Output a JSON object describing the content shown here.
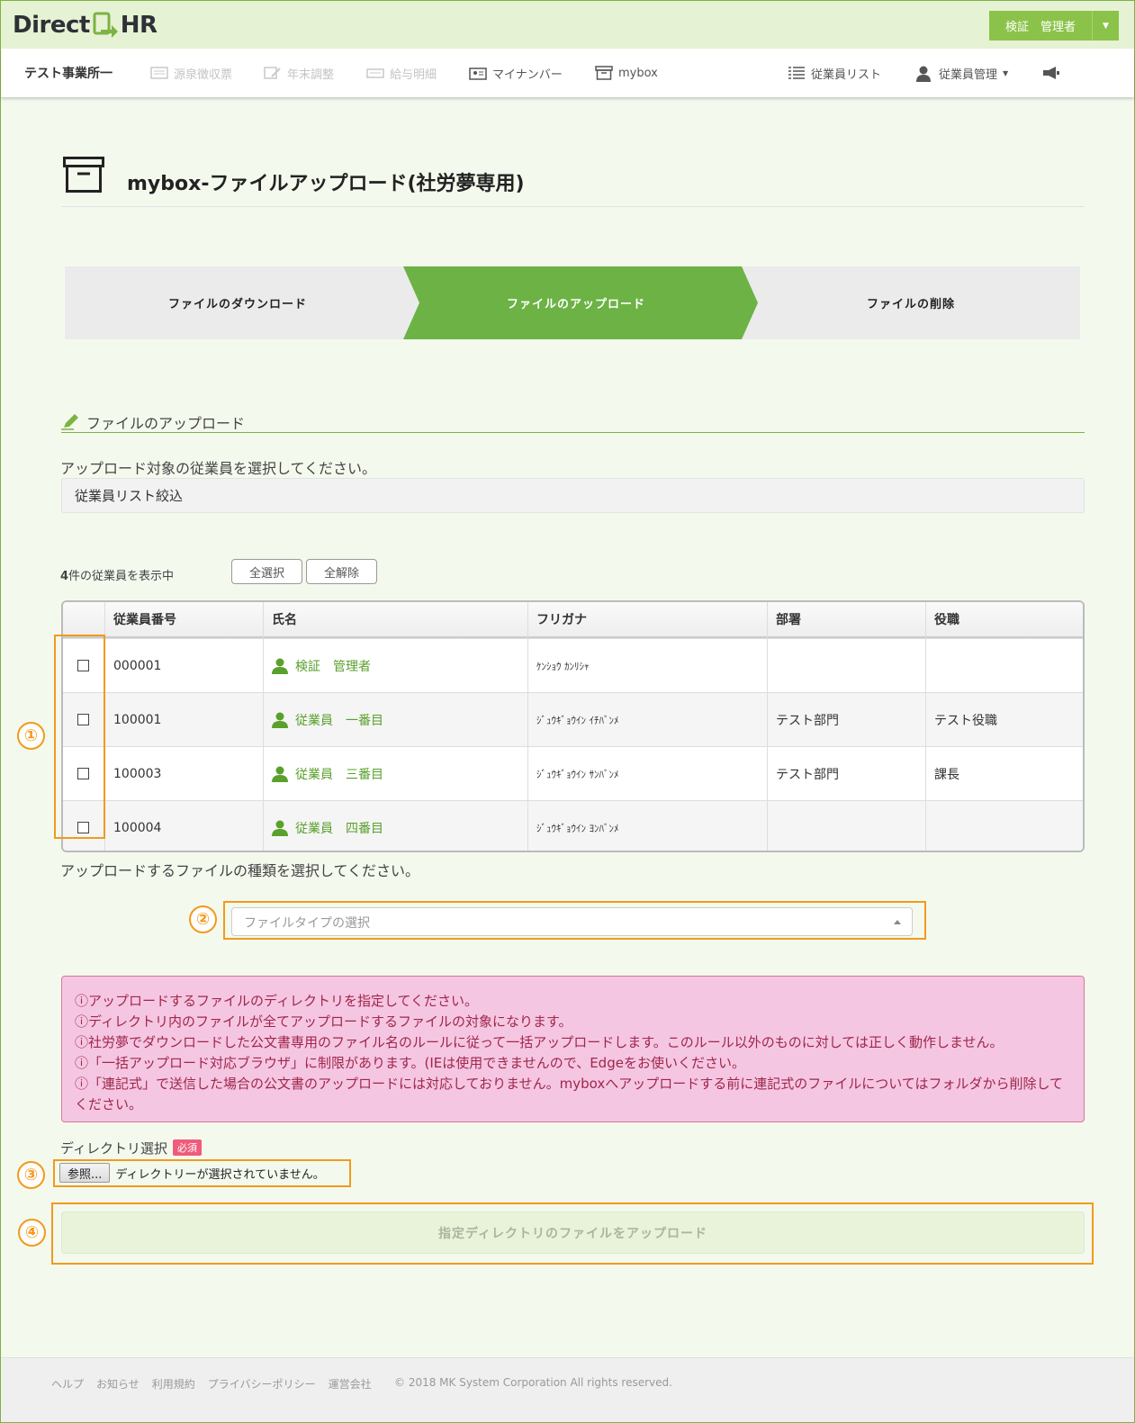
{
  "app": {
    "logo_left": "Direct",
    "logo_right": "HR",
    "user_button": "検証　管理者"
  },
  "nav": {
    "office": "テスト事業所一",
    "items": [
      {
        "label": "源泉徴収票",
        "icon": "receipt-icon",
        "enabled": false
      },
      {
        "label": "年末調整",
        "icon": "edit-doc-icon",
        "enabled": false
      },
      {
        "label": "給与明細",
        "icon": "payslip-icon",
        "enabled": false
      },
      {
        "label": "マイナンバー",
        "icon": "id-card-icon",
        "enabled": true
      },
      {
        "label": "mybox",
        "icon": "archive-box-icon",
        "enabled": true
      }
    ],
    "right_items": [
      {
        "label": "従業員リスト",
        "icon": "list-icon"
      },
      {
        "label": "従業員管理",
        "icon": "user-icon"
      }
    ]
  },
  "page": {
    "title": "mybox-ファイルアップロード(社労夢専用)"
  },
  "steps": [
    {
      "label": "ファイルのダウンロード",
      "active": false
    },
    {
      "label": "ファイルのアップロード",
      "active": true
    },
    {
      "label": "ファイルの削除",
      "active": false
    }
  ],
  "upload": {
    "section_title": "ファイルのアップロード",
    "select_employee_text": "アップロード対象の従業員を選択してください。",
    "filter_label": "従業員リスト絞込",
    "count_number": "4",
    "count_suffix": "件の従業員を表示中",
    "select_all": "全選択",
    "deselect_all": "全解除",
    "file_type_text": "アップロードするファイルの種類を選択してください。",
    "file_type_placeholder": "ファイルタイプの選択",
    "directory_label": "ディレクトリ選択",
    "required_badge": "必須",
    "browse_button": "参照...",
    "no_directory": "ディレクトリーが選択されていません。",
    "submit_button": "指定ディレクトリのファイルをアップロード"
  },
  "table": {
    "headers": [
      "従業員番号",
      "氏名",
      "フリガナ",
      "部署",
      "役職"
    ],
    "rows": [
      {
        "id": "000001",
        "name": "検証　管理者",
        "kana": "ｹﾝｼｮｳ ｶﾝﾘｼｬ",
        "dept": "",
        "role": ""
      },
      {
        "id": "100001",
        "name": "従業員　一番目",
        "kana": "ｼﾞｭｳｷﾞｮｳｲﾝ ｲﾁﾊﾞﾝﾒ",
        "dept": "テスト部門",
        "role": "テスト役職"
      },
      {
        "id": "100003",
        "name": "従業員　三番目",
        "kana": "ｼﾞｭｳｷﾞｮｳｲﾝ ｻﾝﾊﾞﾝﾒ",
        "dept": "テスト部門",
        "role": "課長"
      },
      {
        "id": "100004",
        "name": "従業員　四番目",
        "kana": "ｼﾞｭｳｷﾞｮｳｲﾝ ﾖﾝﾊﾞﾝﾒ",
        "dept": "",
        "role": ""
      }
    ]
  },
  "alert": {
    "lines": [
      "ⓘアップロードするファイルのディレクトリを指定してください。",
      "ⓘディレクトリ内のファイルが全てアップロードするファイルの対象になります。",
      "ⓘ社労夢でダウンロードした公文書専用のファイル名のルールに従って一括アップロードします。このルール以外のものに対しては正しく動作しません。",
      "ⓘ「一括アップロード対応ブラウザ」に制限があります。(IEは使用できませんので、Edgeをお使いください。",
      "ⓘ「連記式」で送信した場合の公文書のアップロードには対応しておりません。myboxへアップロードする前に連記式のファイルについてはフォルダから削除してください。"
    ]
  },
  "annotations": [
    "①",
    "②",
    "③",
    "④"
  ],
  "footer": {
    "links": [
      "ヘルプ",
      "お知らせ",
      "利用規約",
      "プライバシーポリシー",
      "運営会社"
    ],
    "copyright": "© 2018 MK System Corporation All rights reserved."
  },
  "colors": {
    "accent": "#7cb342",
    "step_active": "#6cb245",
    "annotation": "#f29a1d",
    "alert_bg": "#f5c6e2",
    "alert_text": "#a0264a"
  }
}
